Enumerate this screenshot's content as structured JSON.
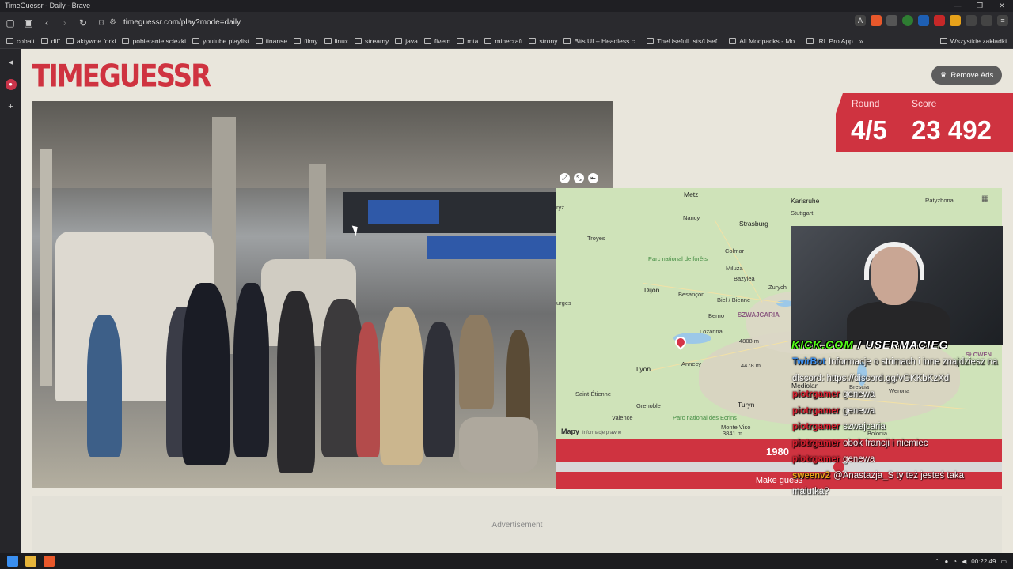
{
  "window": {
    "title": "TimeGuessr - Daily - Brave",
    "controls": [
      "—",
      "❐",
      "✕"
    ]
  },
  "browser": {
    "url": "timeguessr.com/play?mode=daily",
    "bookmarks": [
      "cobalt",
      "diff",
      "aktywne forki",
      "pobieranie sciezki",
      "youtube playlist",
      "finanse",
      "filmy",
      "linux",
      "streamy",
      "java",
      "fivem",
      "mta",
      "minecraft",
      "strony",
      "Bits UI – Headless c...",
      "TheUsefulLists/Usef...",
      "All Modpacks - Mo...",
      "IRL Pro App"
    ],
    "bookmarks_overflow": "»",
    "all_bookmarks": "Wszystkie zakładki"
  },
  "header": {
    "logo": "TIMEGUESSR",
    "remove_ads": "Remove Ads"
  },
  "stats": {
    "round_label": "Round",
    "round_value": "4/5",
    "score_label": "Score",
    "score_value": "23 492"
  },
  "map": {
    "attribution": "Mapy",
    "legal": "Informacje prawne",
    "cities": [
      "Metz",
      "Karlsruhe",
      "Ratyzbona",
      "Nancy",
      "Stuttgart",
      "Strasburg",
      "Troyes",
      "Colmar",
      "Miluza",
      "Bazylea",
      "Zurych",
      "Dijon",
      "Besançon",
      "Biel / Bienne",
      "Berno",
      "Lozanna",
      "Lyon",
      "Annecy",
      "Saint-Étienne",
      "Grenoble",
      "Valence",
      "Turyn",
      "Mediolan",
      "Bolonia",
      "Brescia",
      "Werona",
      "Monte Viso",
      "Parc national de forêts",
      "Parc national des Ecrins",
      "ryż",
      "urges",
      "SŁOWEN"
    ],
    "country": "SZWAJCARIA",
    "peaks": [
      "4478 m",
      "4808 m",
      "3841 m"
    ]
  },
  "guess": {
    "year": "1980",
    "button": "Make guess"
  },
  "stream": {
    "channel_prefix": "KICK.COM",
    "channel_sep": "/",
    "channel_name": "USERMACIEG",
    "chat": [
      {
        "user": "TwirBot",
        "text": "Informacje o strimach i inne znajdziesz na discord: https://discord.gg/vGKKbKzXd"
      },
      {
        "user": "piotrgamer",
        "text": "genewa"
      },
      {
        "user": "piotrgamer",
        "text": "genewa"
      },
      {
        "user": "piotrgamer",
        "text": "szwajcaria"
      },
      {
        "user": "piotrgamer",
        "text": "obok francji i niemiec"
      },
      {
        "user": "piotrgamer",
        "text": "genewa"
      },
      {
        "user": "sweenv2",
        "text": "@Anastazja_S ty też jesteś taka malutka?"
      }
    ]
  },
  "ad": {
    "label": "Advertisement"
  },
  "taskbar": {
    "time": "00:22:49"
  }
}
